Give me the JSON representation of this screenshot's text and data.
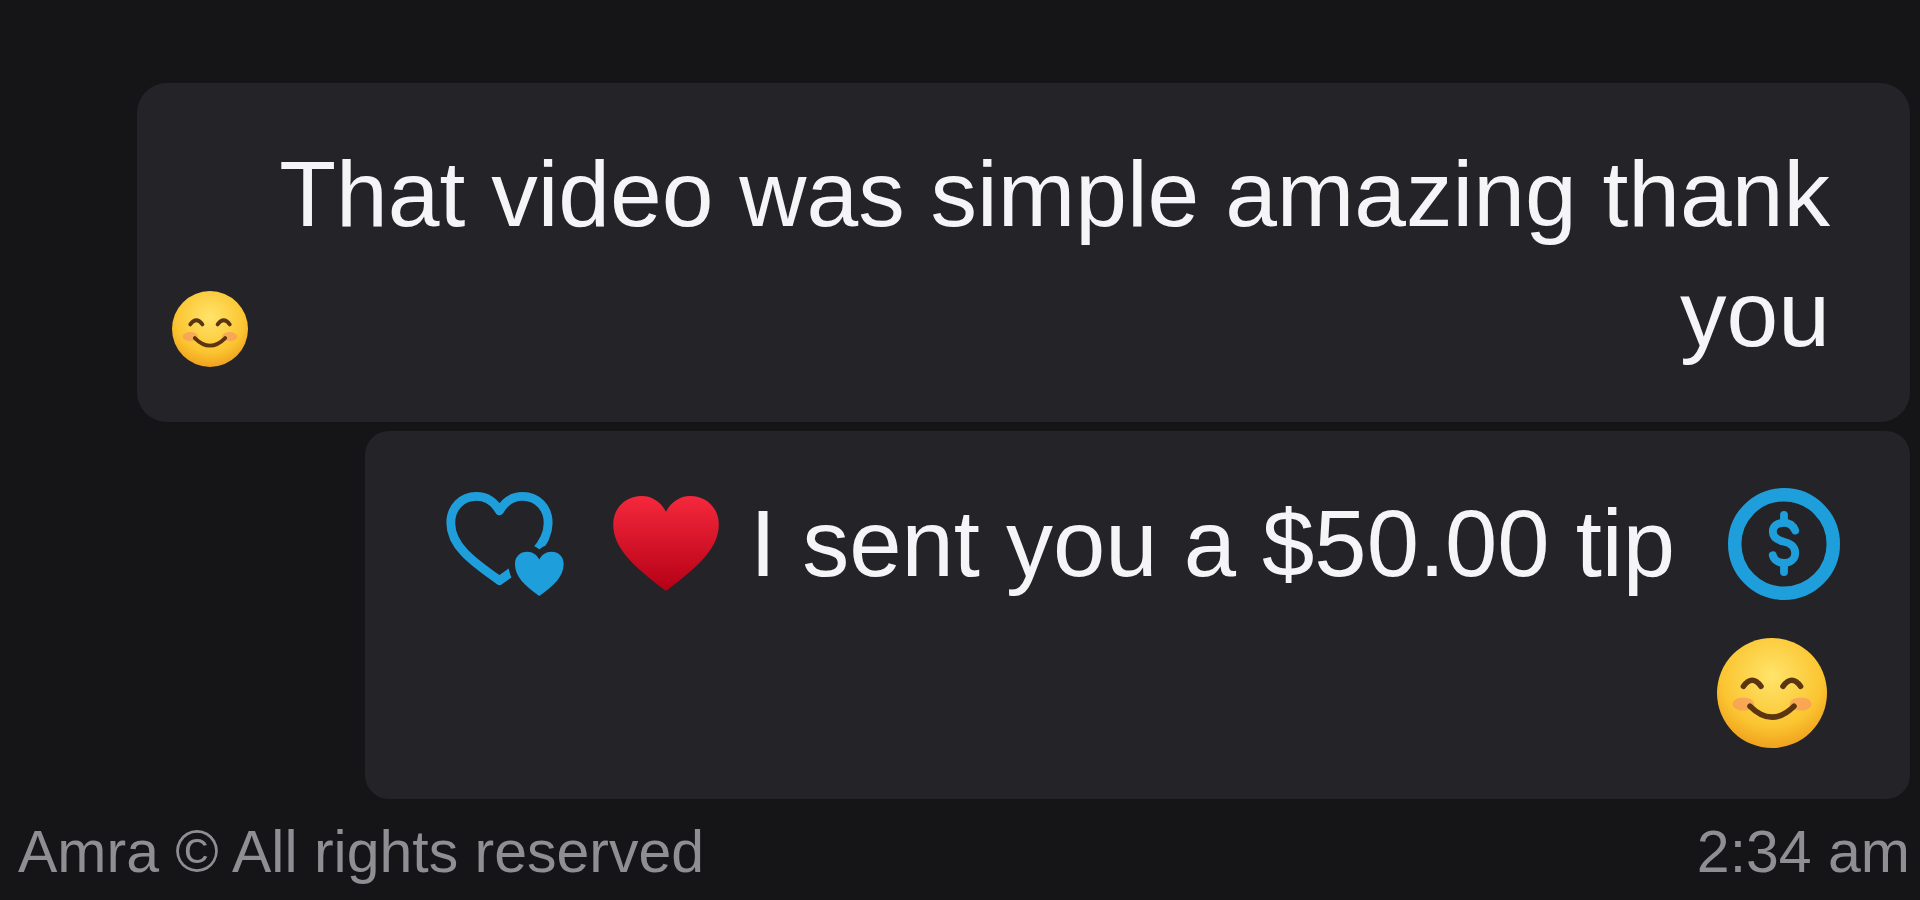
{
  "messages": [
    {
      "kind": "text",
      "text": "That video was simple amazing thank you"
    },
    {
      "kind": "tip",
      "text": "I sent you a $50.00 tip"
    }
  ],
  "footer": {
    "time": "2:34 am",
    "copyright": "Amra © All rights reserved"
  }
}
